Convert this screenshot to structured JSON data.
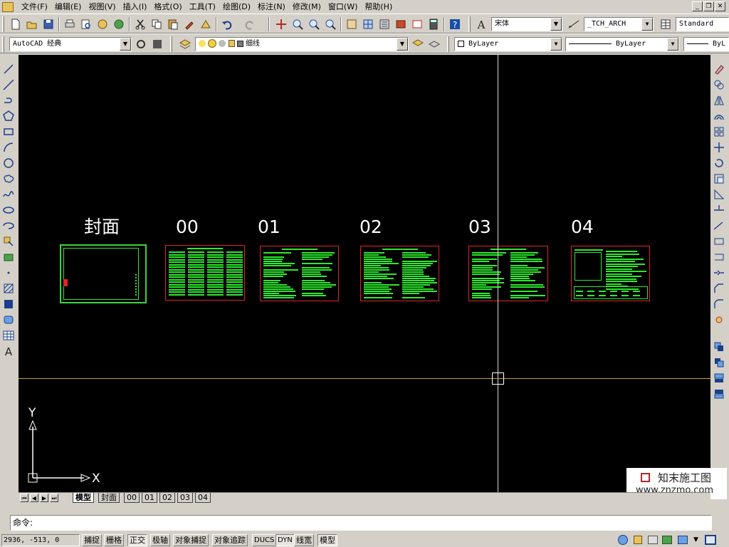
{
  "menu": [
    "文件(F)",
    "编辑(E)",
    "视图(V)",
    "插入(I)",
    "格式(O)",
    "工具(T)",
    "绘图(D)",
    "标注(N)",
    "修改(M)",
    "窗口(W)",
    "帮助(H)"
  ],
  "toolbar1": {
    "font_combo": "宋体",
    "dimstyle_combo": "_TCH_ARCH",
    "textstyle_combo": "Standard"
  },
  "toolbar2": {
    "workspace_combo": "AutoCAD 经典",
    "layer_combo": "细线",
    "color_combo": "ByLayer",
    "linetype_combo": "ByLayer",
    "lineweight_combo": "ByL"
  },
  "drawing": {
    "sheets": [
      {
        "label": "封面",
        "kind": "cover"
      },
      {
        "label": "00",
        "kind": "table"
      },
      {
        "label": "01",
        "kind": "text"
      },
      {
        "label": "02",
        "kind": "text"
      },
      {
        "label": "03",
        "kind": "text"
      },
      {
        "label": "04",
        "kind": "detail"
      }
    ],
    "ucs": {
      "x_label": "X",
      "y_label": "Y"
    },
    "colors": {
      "background": "#000000",
      "sheet_border": "#e0232a",
      "content": "#2ee82e",
      "crosshair": "#ffffff"
    }
  },
  "tabs": [
    "模型",
    "封面",
    "00",
    "01",
    "02",
    "03",
    "04"
  ],
  "command": {
    "prompt": "命令:"
  },
  "status": {
    "coords": "2936, -513, 0",
    "buttons": [
      {
        "label": "捕捉",
        "on": false
      },
      {
        "label": "栅格",
        "on": false
      },
      {
        "label": "正交",
        "on": true
      },
      {
        "label": "极轴",
        "on": false
      },
      {
        "label": "对象捕捉",
        "on": false
      },
      {
        "label": "对象追踪",
        "on": false
      },
      {
        "label": "DUCS",
        "on": false
      },
      {
        "label": "DYN",
        "on": true
      },
      {
        "label": "线宽",
        "on": false
      },
      {
        "label": "模型",
        "on": true
      }
    ]
  },
  "watermark": {
    "title": "知末施工图",
    "url": "www.znzmo.com"
  }
}
